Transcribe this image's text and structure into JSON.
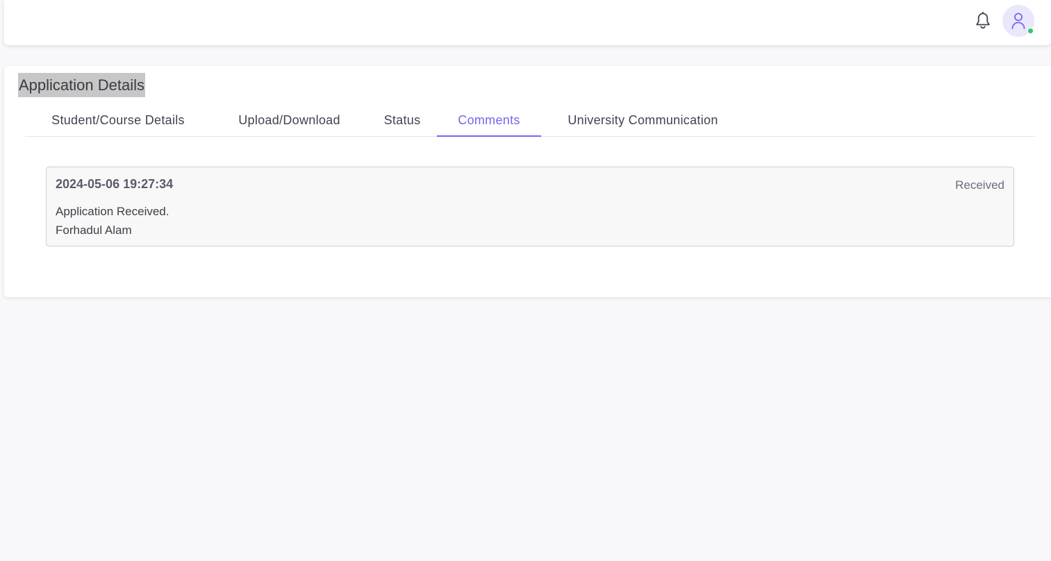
{
  "navbar": {
    "notification_icon": "bell-icon",
    "avatar_icon": "user-icon",
    "online_status_color": "#28c76f"
  },
  "page": {
    "title": "Application Details"
  },
  "tabs": [
    {
      "label": "Student/Course Details",
      "active": false
    },
    {
      "label": "Upload/Download",
      "active": false
    },
    {
      "label": "Status",
      "active": false
    },
    {
      "label": "Comments",
      "active": true
    },
    {
      "label": "University Communication",
      "active": false
    }
  ],
  "comments": [
    {
      "timestamp": "2024-05-06 19:27:34",
      "status": "Received",
      "message": "Application Received.",
      "author": "Forhadul Alam"
    }
  ],
  "colors": {
    "accent": "#7367f0",
    "online": "#28c76f"
  }
}
